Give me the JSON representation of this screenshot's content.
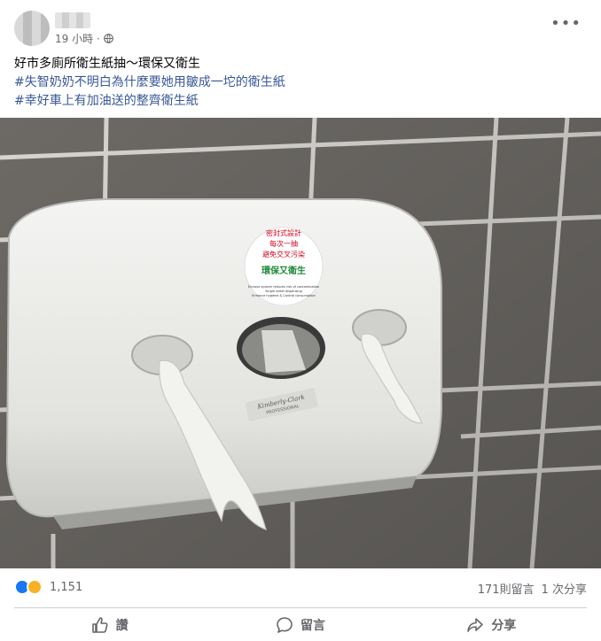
{
  "post": {
    "time_label": "19 小時 ·",
    "privacy_icon": "globe-icon",
    "more_label": "•••",
    "text_lines": {
      "line1": "好市多廁所衛生紙抽～環保又衛生",
      "line2": "#失智奶奶不明白為什麼要她用皺成一坨的衛生紙",
      "line3": "#幸好車上有加油送的整齊衛生紙"
    },
    "photo": {
      "sticker_lines": [
        "密封式設計",
        "每次一抽",
        "避免交叉污染"
      ],
      "sticker_green": "環保又衛生",
      "sticker_small": [
        "Enclose system reduces risk of contamination",
        "Single sheet dispensing",
        "Enhance hygiene & Control consumption"
      ],
      "brand_label": "Kimberly-Clark",
      "brand_sub": "PROFESSIONAL"
    }
  },
  "reactions": {
    "count": "1,151",
    "icons": [
      "like-icon",
      "haha-icon"
    ]
  },
  "stats": {
    "comments": "171則留言",
    "shares": "1 次分享"
  },
  "actions": {
    "like": "讚",
    "comment": "留言",
    "share": "分享"
  },
  "colors": {
    "hashtag": "#385898",
    "secondary_text": "#65676b",
    "like_blue": "#1877f2",
    "haha_yellow": "#f7b125",
    "divider": "#ced0d4",
    "sticker_red": "#d0021b",
    "sticker_green": "#1e8b3a"
  }
}
